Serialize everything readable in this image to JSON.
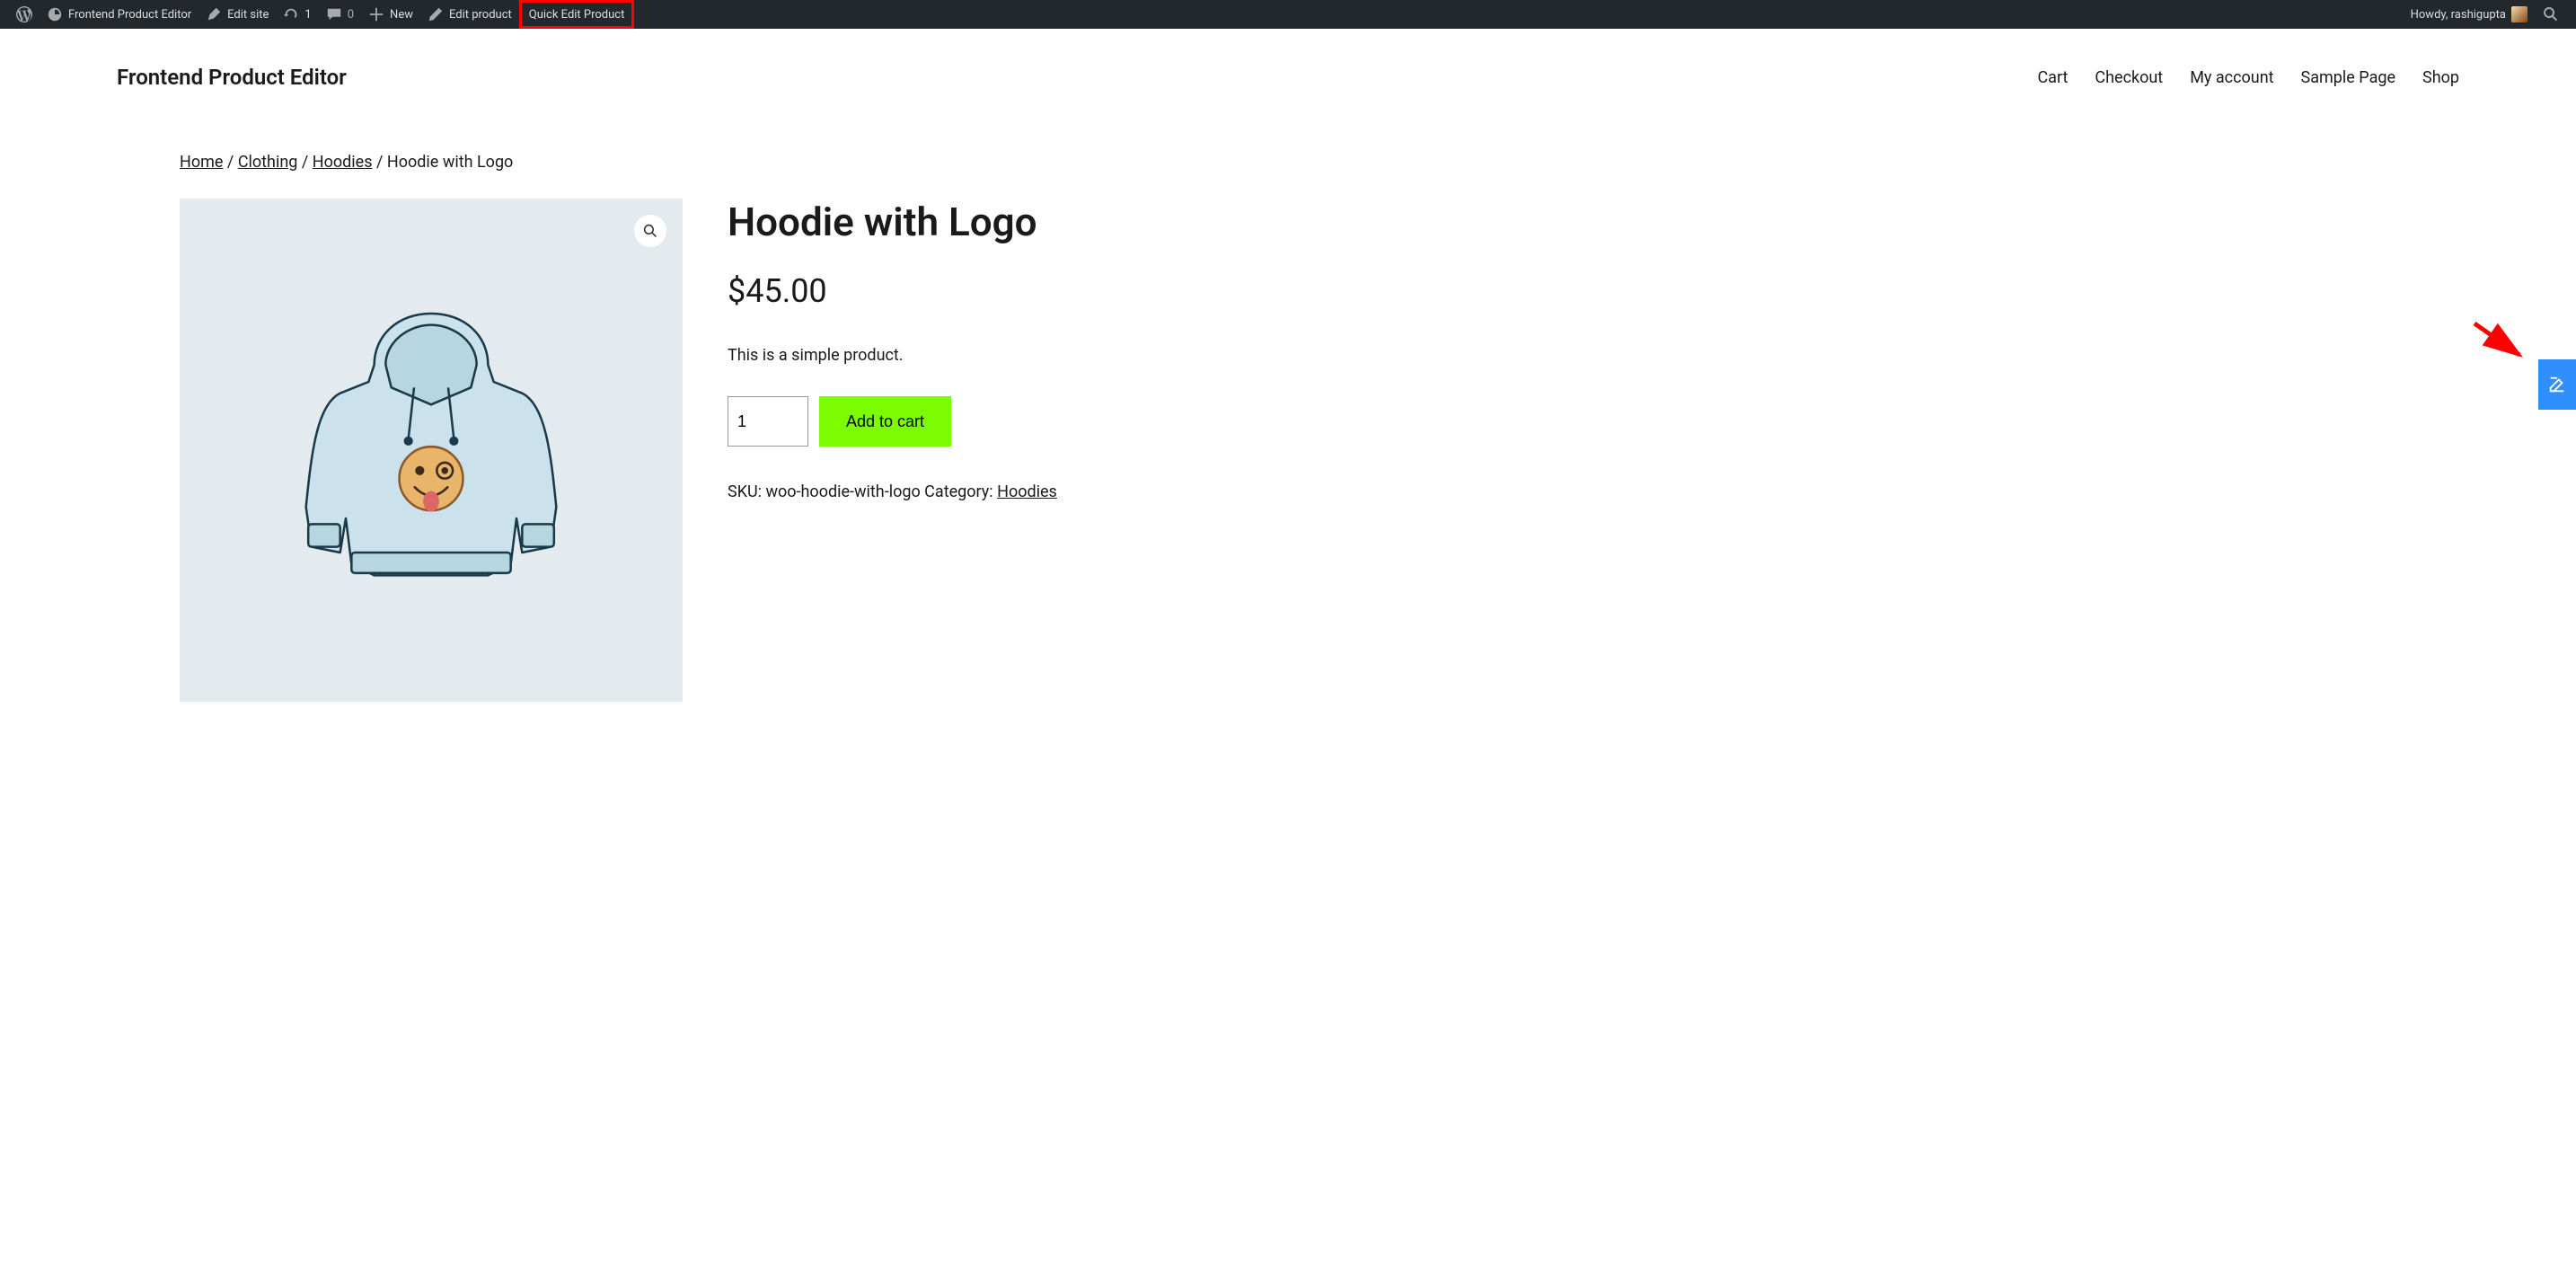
{
  "adminbar": {
    "site_name": "Frontend Product Editor",
    "edit_site": "Edit site",
    "updates_count": "1",
    "comments_count": "0",
    "new_label": "New",
    "edit_product": "Edit product",
    "quick_edit_product": "Quick Edit Product",
    "greeting": "Howdy, rashigupta"
  },
  "header": {
    "site_title": "Frontend Product Editor",
    "nav": {
      "cart": "Cart",
      "checkout": "Checkout",
      "account": "My account",
      "sample": "Sample Page",
      "shop": "Shop"
    }
  },
  "breadcrumb": {
    "home": "Home",
    "clothing": "Clothing",
    "hoodies": "Hoodies",
    "current": "Hoodie with Logo"
  },
  "product": {
    "title": "Hoodie with Logo",
    "price": "$45.00",
    "description": "This is a simple product.",
    "qty": "1",
    "add_to_cart": "Add to cart",
    "sku_label": "SKU: ",
    "sku_value": "woo-hoodie-with-logo",
    "category_label": " Category: ",
    "category_value": "Hoodies"
  }
}
